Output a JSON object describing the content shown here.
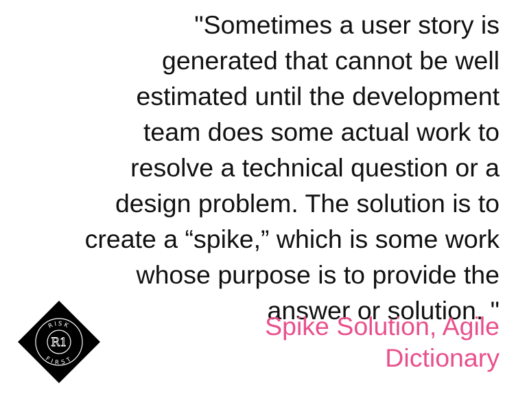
{
  "quote": {
    "lines": [
      "\"Sometimes a user story is",
      "generated that cannot be well",
      "estimated until the development",
      "team does some actual work to",
      "resolve a technical question or a",
      "design problem. The solution is to",
      "create a “spike,” which is some work",
      "whose purpose is to provide the",
      "answer or solution. \""
    ]
  },
  "attribution": {
    "lines": [
      "Spike Solution, Agile",
      "Dictionary"
    ]
  },
  "logo": {
    "top_text": "RISK",
    "monogram": "R1",
    "bottom_text": "FIRST",
    "icon": "risk-first-logo"
  },
  "colors": {
    "text": "#111111",
    "accent": "#e8508b",
    "logo_fill": "#000000",
    "logo_line": "#ffffff"
  }
}
